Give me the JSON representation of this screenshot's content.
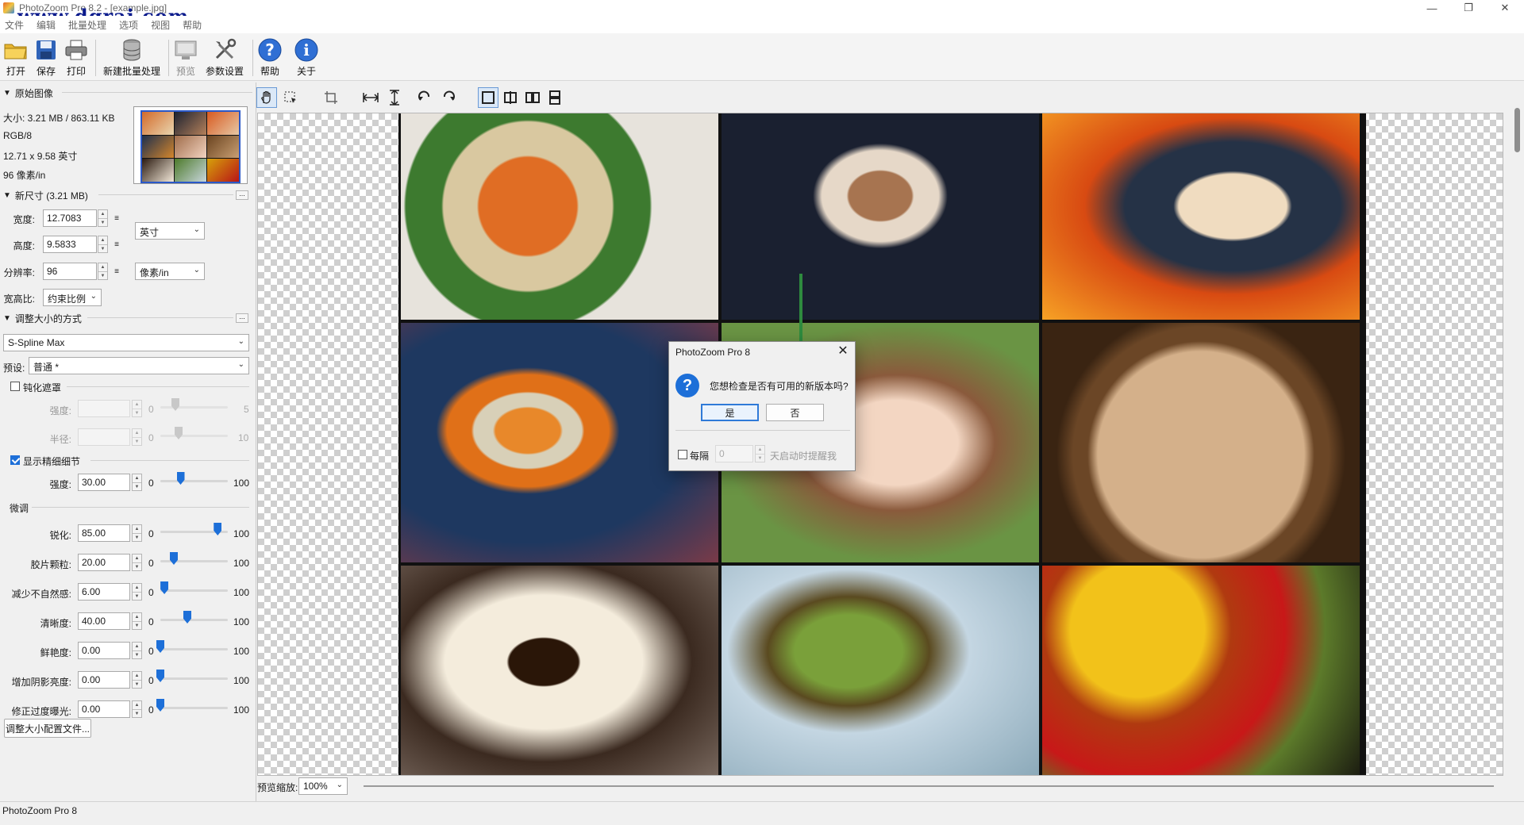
{
  "window": {
    "title": "PhotoZoom Pro 8.2 - [example.jpg]",
    "watermark": "www.dgrai.com",
    "controls": [
      "—",
      "❐",
      "✕"
    ]
  },
  "menu": [
    "文件",
    "编辑",
    "批量处理",
    "选项",
    "视图",
    "帮助"
  ],
  "toolbar": {
    "open": "打开",
    "save": "保存",
    "print": "打印",
    "batch": "新建批量处理",
    "preview": "预览",
    "settings": "参数设置",
    "help": "帮助",
    "about": "关于"
  },
  "original": {
    "header": "原始图像",
    "size": "大小: 3.21 MB / 863.11 KB",
    "mode": "RGB/8",
    "dims": "12.71 x 9.58 英寸",
    "res": "96 像素/in"
  },
  "newsize": {
    "header": "新尺寸 (3.21 MB)",
    "more": "...",
    "width_label": "宽度:",
    "width": "12.7083",
    "height_label": "高度:",
    "height": "9.5833",
    "res_label": "分辨率:",
    "res": "96",
    "link_glyph": "≡",
    "unit": "英寸",
    "res_unit": "像素/in",
    "aspect_label": "宽高比:",
    "aspect": "约束比例"
  },
  "resize": {
    "header": "调整大小的方式",
    "more": "...",
    "method": "S-Spline Max",
    "preset_label": "预设:",
    "preset": "普通 *",
    "unsharp_label": "钝化遮罩",
    "unsharp_checked": false,
    "strength_label": "强度:",
    "radius_label": "半径:",
    "us_strength_max": "5",
    "us_radius_max": "10",
    "detail_label": "显示精细细节",
    "detail_checked": true,
    "detail_strength": "30.00",
    "detail_strength_pct": 0.3,
    "fine_header": "微调",
    "min": "0",
    "max": "100",
    "fine": [
      {
        "label": "锐化:",
        "value": "85.00",
        "pct": 0.85
      },
      {
        "label": "胶片颗粒:",
        "value": "20.00",
        "pct": 0.2
      },
      {
        "label": "减少不自然感:",
        "value": "6.00",
        "pct": 0.06
      },
      {
        "label": "清晰度:",
        "value": "40.00",
        "pct": 0.4
      },
      {
        "label": "鲜艳度:",
        "value": "0.00",
        "pct": 0.0
      },
      {
        "label": "增加阴影亮度:",
        "value": "0.00",
        "pct": 0.0
      },
      {
        "label": "修正过度曝光:",
        "value": "0.00",
        "pct": 0.0
      }
    ],
    "profile_btn": "调整大小配置文件..."
  },
  "preview": {
    "zoom_label": "预览缩放:",
    "zoom": "100%"
  },
  "status": "PhotoZoom Pro 8",
  "dialog": {
    "title": "PhotoZoom Pro 8",
    "question_glyph": "?",
    "message": "您想检查是否有可用的新版本吗?",
    "yes": "是",
    "no": "否",
    "every_label": "每隔",
    "days": "0",
    "days_suffix": "天启动时提醒我"
  },
  "colors": {
    "accent": "#1d6fd8",
    "arrow": "#2e8b3e"
  }
}
